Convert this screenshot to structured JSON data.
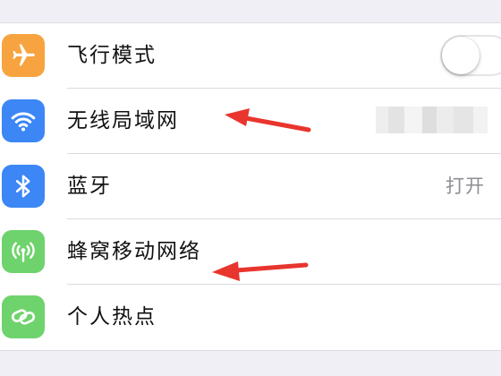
{
  "colors": {
    "airplane_tile": "#f7a440",
    "wifi_tile": "#3c86f6",
    "bluetooth_tile": "#3c86f6",
    "cellular_tile": "#6ed36d",
    "hotspot_tile": "#6ed36d",
    "annotation_arrow": "#e8352d",
    "page_background": "#f0eff5",
    "separator": "#dcdce0"
  },
  "settings": {
    "rows": [
      {
        "label": "飞行模式",
        "icon": "airplane-icon",
        "accessory": "toggle",
        "toggle_on": false
      },
      {
        "label": "无线局域网",
        "icon": "wifi-icon",
        "accessory": "pixelated-network-name"
      },
      {
        "label": "蓝牙",
        "icon": "bluetooth-icon",
        "accessory": "detail",
        "detail": "打开"
      },
      {
        "label": "蜂窝移动网络",
        "icon": "cellular-antenna-icon",
        "accessory": "none"
      },
      {
        "label": "个人热点",
        "icon": "personal-hotspot-icon",
        "accessory": "none"
      }
    ]
  },
  "annotations": [
    {
      "type": "arrow",
      "points_to": "无线局域网",
      "color": "#e8352d"
    },
    {
      "type": "arrow",
      "points_to": "蜂窝移动网络",
      "color": "#e8352d"
    }
  ]
}
